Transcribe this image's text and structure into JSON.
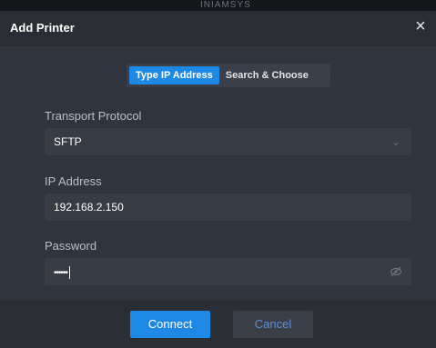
{
  "background": {
    "fragment_text": "INIAMSYS"
  },
  "dialog": {
    "title": "Add Printer",
    "close_icon": "close-icon",
    "tabs": [
      {
        "label": "Type IP Address",
        "active": true
      },
      {
        "label": "Search & Choose",
        "active": false
      }
    ],
    "transport": {
      "label": "Transport Protocol",
      "value": "SFTP",
      "icon": "chevron-down-icon"
    },
    "ip": {
      "label": "IP Address",
      "value": "192.168.2.150"
    },
    "password": {
      "label": "Password",
      "masked_value": "••••••",
      "icon": "eye-off-icon"
    },
    "buttons": {
      "connect": "Connect",
      "cancel": "Cancel"
    }
  },
  "colors": {
    "accent": "#1e88e5",
    "dialog_bg": "#30343c",
    "field_bg": "#383c44"
  }
}
